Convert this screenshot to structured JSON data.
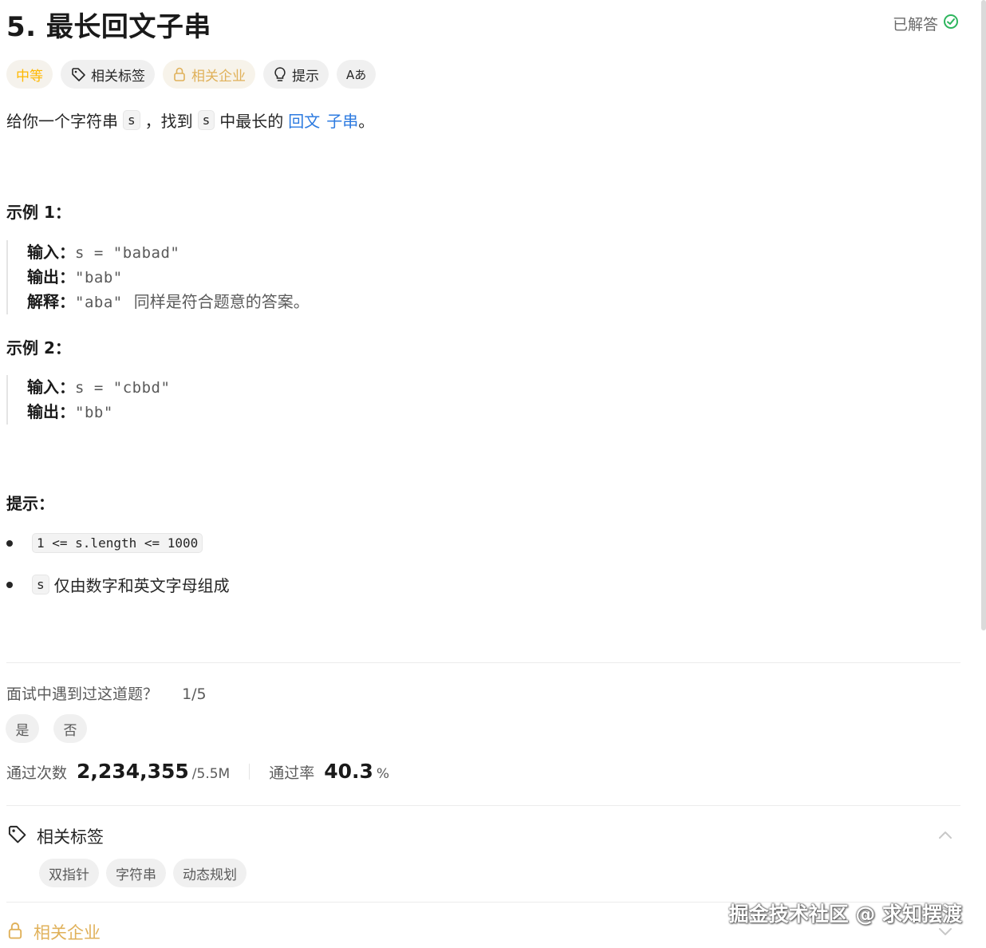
{
  "problem": {
    "title": "5. 最长回文子串",
    "solved_label": "已解答"
  },
  "tags_bar": {
    "difficulty": "中等",
    "related_tags": "相关标签",
    "related_companies": "相关企业",
    "hint": "提示",
    "font_toggle": "Aあ"
  },
  "description": {
    "part1": "给你一个字符串",
    "code1": "s",
    "part2": "，找到",
    "code2": "s",
    "part3": "中最长的",
    "link1": "回文",
    "link2": "子串",
    "part4": "。"
  },
  "examples": [
    {
      "heading": "示例 1：",
      "input_label": "输入：",
      "input_value": "s = \"babad\"",
      "output_label": "输出：",
      "output_value": "\"bab\"",
      "explain_label": "解释：",
      "explain_value": "\"aba\"",
      "explain_text": "同样是符合题意的答案。"
    },
    {
      "heading": "示例 2：",
      "input_label": "输入：",
      "input_value": "s = \"cbbd\"",
      "output_label": "输出：",
      "output_value": "\"bb\""
    }
  ],
  "constraints": {
    "heading": "提示：",
    "items": [
      {
        "code": "1 <= s.length <= 1000",
        "text": ""
      },
      {
        "code": "s",
        "text": "仅由数字和英文字母组成"
      }
    ]
  },
  "interview": {
    "question": "面试中遇到过这道题？",
    "fraction": "1/5",
    "yes": "是",
    "no": "否"
  },
  "stats": {
    "accepted_label": "通过次数",
    "accepted_value": "2,234,355",
    "submissions": "/5.5M",
    "rate_label": "通过率",
    "rate_value": "40.3",
    "rate_unit": "%"
  },
  "topics": {
    "heading": "相关标签",
    "items": [
      "双指针",
      "字符串",
      "动态规划"
    ]
  },
  "companies": {
    "heading": "相关企业"
  },
  "watermark": "掘金技术社区 @ 求知摆渡",
  "colors": {
    "medium": "#ffb800",
    "link": "#2d7be0",
    "solved_check": "#2db55d"
  }
}
